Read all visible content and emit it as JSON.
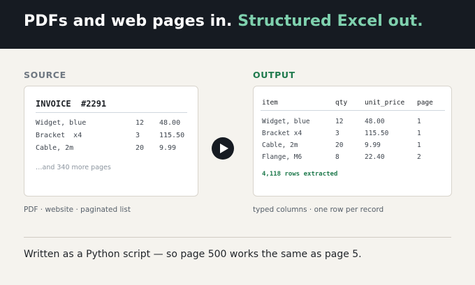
{
  "header": {
    "title_plain": "PDFs and web pages in. ",
    "title_accent": "Structured Excel out."
  },
  "source": {
    "label": "SOURCE",
    "invoice_title": "INVOICE  #2291",
    "rows": [
      {
        "item": "Widget, blue",
        "qty": "12",
        "price": "48.00"
      },
      {
        "item": "Bracket  x4",
        "qty": "3",
        "price": "115.50"
      },
      {
        "item": "Cable, 2m",
        "qty": "20",
        "price": "9.99"
      }
    ],
    "more_pages": "…and 340 more pages",
    "caption": "PDF · website · paginated list"
  },
  "output": {
    "label": "OUTPUT",
    "columns": [
      "item",
      "qty",
      "unit_price",
      "page"
    ],
    "rows": [
      [
        "Widget, blue",
        "12",
        "48.00",
        "1"
      ],
      [
        "Bracket x4",
        "3",
        "115.50",
        "1"
      ],
      [
        "Cable, 2m",
        "20",
        "9.99",
        "1"
      ],
      [
        "Flange, M6",
        "8",
        "22.40",
        "2"
      ]
    ],
    "rows_extracted": "4,118 rows extracted",
    "caption": "typed columns · one row per record"
  },
  "play_icon": "play-icon",
  "footer": {
    "text": "Written as a Python script — so page 500 works the same as page 5."
  },
  "colors": {
    "header_bg": "#161b22",
    "accent_green": "#7fd1ae",
    "output_green": "#1f7a4d",
    "page_bg": "#f5f3ee"
  }
}
